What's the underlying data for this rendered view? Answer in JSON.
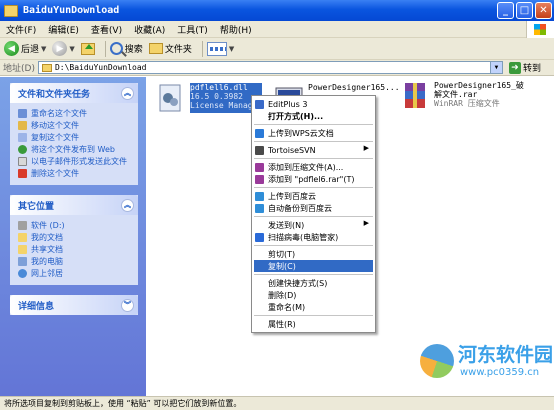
{
  "window": {
    "title": "BaiduYunDownload",
    "buttons": {
      "minimize": "_",
      "maximize": "□",
      "close": "✕"
    }
  },
  "menubar": {
    "items": [
      "文件(F)",
      "编辑(E)",
      "查看(V)",
      "收藏(A)",
      "工具(T)",
      "帮助(H)"
    ]
  },
  "toolbar": {
    "back_label": "后退",
    "search_label": "搜索",
    "folders_label": "文件夹"
  },
  "address": {
    "label": "地址(D)",
    "path": "D:\\BaiduYunDownload",
    "go_label": "转到"
  },
  "left_panel": {
    "tasks": {
      "title": "文件和文件夹任务",
      "items": [
        "重命名这个文件",
        "移动这个文件",
        "复制这个文件",
        "将这个文件发布到 Web",
        "以电子邮件形式发送此文件",
        "删除这个文件"
      ]
    },
    "places": {
      "title": "其它位置",
      "items": [
        "软件 (D:)",
        "我的文档",
        "共享文档",
        "我的电脑",
        "网上邻居"
      ]
    },
    "details": {
      "title": "详细信息"
    }
  },
  "files": [
    {
      "name": "pdflell6.dll",
      "line2": "16.5 0.3982",
      "line3": "License Manager",
      "icon": "dll-file-icon",
      "selected": true
    },
    {
      "name": "PowerDesigner165...",
      "line2": "",
      "line3": "",
      "icon": "installer-icon",
      "selected": false
    },
    {
      "name": "PowerDesigner165_破",
      "line2": "解文件.rar",
      "line3": "WinRAR 压缩文件",
      "icon": "winrar-archive-icon",
      "selected": false
    }
  ],
  "context_menu": {
    "items": [
      {
        "label": "EditPlus 3",
        "icon": "editplus-icon"
      },
      {
        "label": "打开方式(H)...",
        "icon": "",
        "bold": true
      },
      {
        "sep": true
      },
      {
        "label": "上传到WPS云文档",
        "icon": "wps-cloud-icon"
      },
      {
        "sep": true
      },
      {
        "label": "TortoiseSVN",
        "icon": "tortoisesvn-icon",
        "submenu": true
      },
      {
        "sep": true
      },
      {
        "label": "添加到压缩文件(A)...",
        "icon": "winrar-icon"
      },
      {
        "label": "添加到 \"pdflel6.rar\"(T)",
        "icon": "winrar-icon"
      },
      {
        "sep": true
      },
      {
        "label": "上传到百度云",
        "icon": "baidu-cloud-icon"
      },
      {
        "label": "自动备份到百度云",
        "icon": "baidu-cloud-icon"
      },
      {
        "sep": true
      },
      {
        "label": "发送到(N)",
        "icon": "",
        "submenu": true
      },
      {
        "label": "扫描病毒(电脑管家)",
        "icon": "shield-icon"
      },
      {
        "sep": true
      },
      {
        "label": "剪切(T)",
        "icon": ""
      },
      {
        "label": "复制(C)",
        "icon": "",
        "highlighted": true
      },
      {
        "sep": true
      },
      {
        "label": "创建快捷方式(S)",
        "icon": ""
      },
      {
        "label": "删除(D)",
        "icon": ""
      },
      {
        "label": "重命名(M)",
        "icon": ""
      },
      {
        "sep": true
      },
      {
        "label": "属性(R)",
        "icon": ""
      }
    ]
  },
  "statusbar": {
    "text": "将所选项目复制到剪贴板上，使用 “粘贴” 可以把它们放到新位置。"
  },
  "watermark": {
    "title": "河东软件园",
    "url": "www.pc0359.cn"
  },
  "colors": {
    "title_bar": "#0a55df",
    "task_pane": "#6375d6",
    "selection": "#316ac5",
    "link": "#215dc6"
  }
}
